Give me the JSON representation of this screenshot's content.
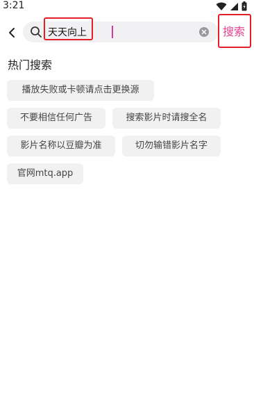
{
  "status_bar": {
    "time": "3:21"
  },
  "search": {
    "value": "天天向上",
    "placeholder": ""
  },
  "search_button_label": "搜索",
  "hot_search": {
    "title": "热门搜索",
    "items": [
      "播放失败或卡顿请点击更换源",
      "不要相信任何广告",
      "搜索影片时请搜全名",
      "影片名称以豆瓣为准",
      "切勿输错影片名字",
      "官网mtq.app"
    ]
  },
  "colors": {
    "accent": "#e0448f",
    "highlight": "#e21f26",
    "chip_bg": "#f1f1f2"
  },
  "icons": [
    "wifi-icon",
    "signal-icon",
    "battery-icon",
    "back-arrow-icon",
    "search-icon",
    "clear-icon"
  ]
}
